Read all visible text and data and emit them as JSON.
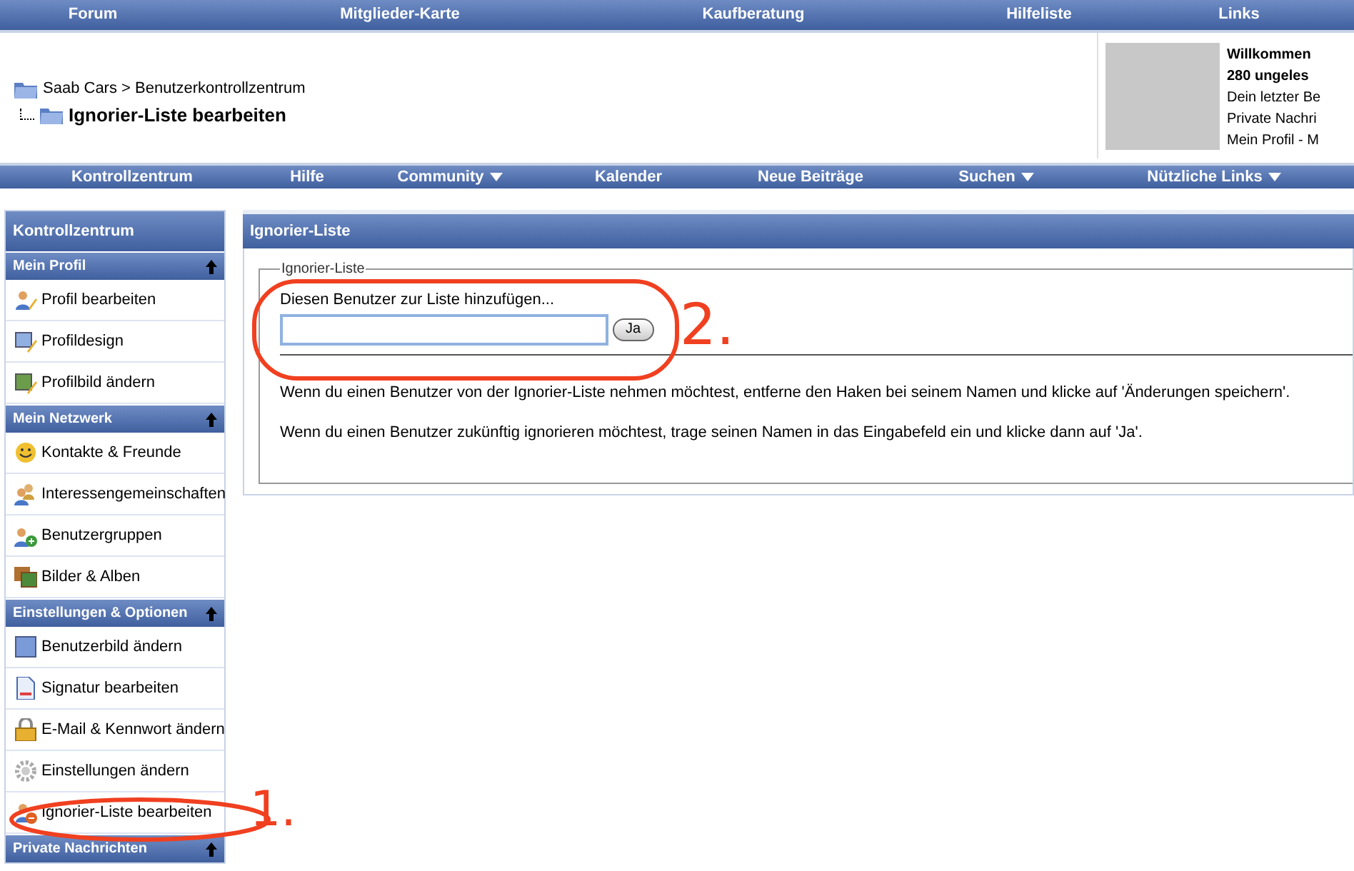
{
  "top_nav": [
    "Forum",
    "Mitglieder-Karte",
    "Kaufberatung",
    "Hilfeliste",
    "Links"
  ],
  "breadcrumb": {
    "parent": "Saab Cars > Benutzerkontrollzentrum",
    "current": "Ignorier-Liste bearbeiten"
  },
  "welcome": {
    "lines": [
      {
        "text": "Willkommen",
        "bold": true
      },
      {
        "text": "280 ungeles",
        "bold": true
      },
      {
        "text": "Dein letzter Be",
        "bold": false
      },
      {
        "text": "Private Nachri",
        "bold": false
      },
      {
        "text": "Mein Profil - M",
        "bold": false
      }
    ]
  },
  "main_nav": [
    {
      "label": "Kontrollzentrum",
      "dropdown": false
    },
    {
      "label": "Hilfe",
      "dropdown": false
    },
    {
      "label": "Community",
      "dropdown": true
    },
    {
      "label": "Kalender",
      "dropdown": false
    },
    {
      "label": "Neue Beiträge",
      "dropdown": false
    },
    {
      "label": "Suchen",
      "dropdown": true
    },
    {
      "label": "Nützliche Links",
      "dropdown": true
    }
  ],
  "sidebar": {
    "title": "Kontrollzentrum",
    "sections": [
      {
        "title": "Mein Profil",
        "items": [
          {
            "label": "Profil bearbeiten",
            "kind": "profile"
          },
          {
            "label": "Profildesign",
            "kind": "design"
          },
          {
            "label": "Profilbild ändern",
            "kind": "picture"
          }
        ]
      },
      {
        "title": "Mein Netzwerk",
        "items": [
          {
            "label": "Kontakte & Freunde",
            "kind": "smiley"
          },
          {
            "label": "Interessengemeinschaften",
            "kind": "users"
          },
          {
            "label": "Benutzergruppen",
            "kind": "group"
          },
          {
            "label": "Bilder & Alben",
            "kind": "album"
          }
        ]
      },
      {
        "title": "Einstellungen & Optionen",
        "items": [
          {
            "label": "Benutzerbild ändern",
            "kind": "avatar"
          },
          {
            "label": "Signatur bearbeiten",
            "kind": "document"
          },
          {
            "label": "E-Mail & Kennwort ändern",
            "kind": "lock"
          },
          {
            "label": "Einstellungen ändern",
            "kind": "gear"
          },
          {
            "label": "Ignorier-Liste bearbeiten",
            "kind": "ignore"
          }
        ]
      },
      {
        "title": "Private Nachrichten"
      }
    ]
  },
  "panel": {
    "title": "Ignorier-Liste",
    "legend": "Ignorier-Liste",
    "field_label": "Diesen Benutzer zur Liste hinzufügen...",
    "button": "Ja",
    "paragraphs": [
      "Wenn du einen Benutzer von der Ignorier-Liste nehmen möchtest, entferne den Haken bei seinem Namen und klicke auf 'Änderungen speichern'.",
      "Wenn du einen Benutzer zukünftig ignorieren möchtest, trage seinen Namen in das Eingabefeld ein und klicke dann auf 'Ja'."
    ]
  },
  "annotations": [
    "1.",
    "2."
  ]
}
